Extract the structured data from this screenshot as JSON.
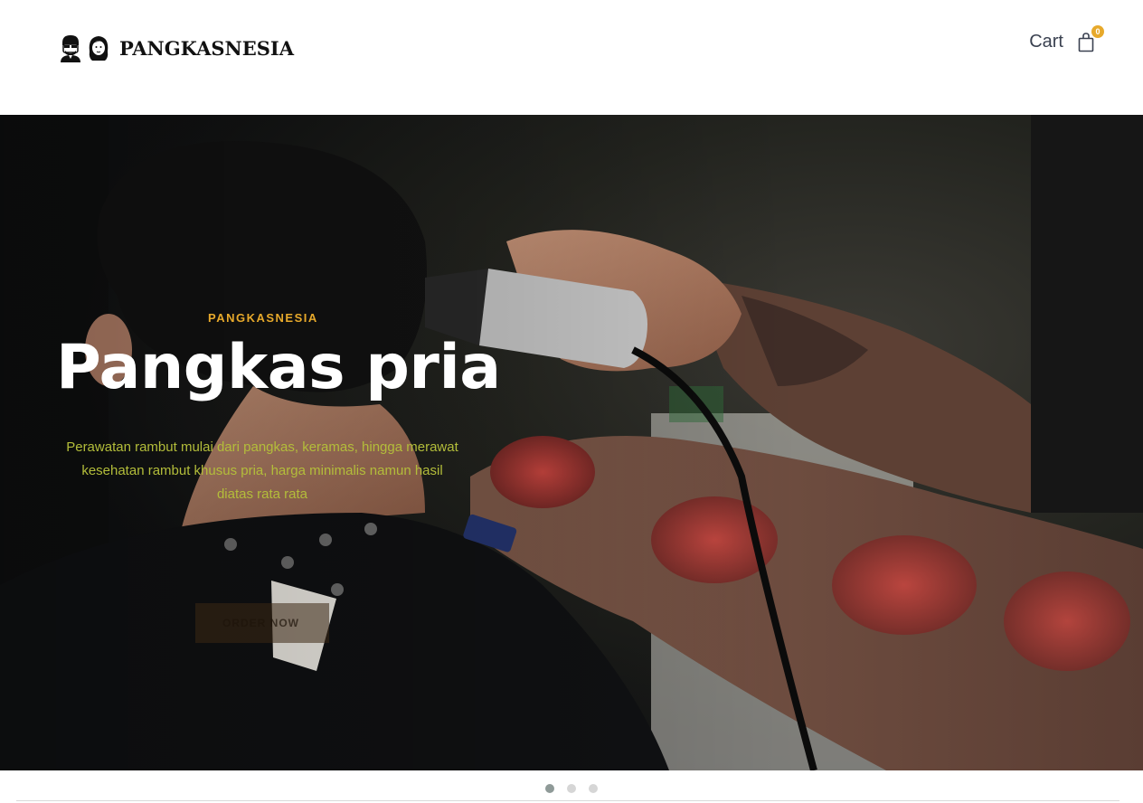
{
  "header": {
    "logo_text": "PANGKASNESIA",
    "cart_label": "Cart",
    "cart_count": "0"
  },
  "hero": {
    "kicker": "PANGKASNESIA",
    "title": "Pangkas pria",
    "description": "Perawatan rambut mulai dari pangkas, keramas, hingga merawat kesehatan rambut khusus pria, harga minimalis namun hasil diatas rata rata",
    "button_label": "ORDER NOW"
  },
  "slider": {
    "slide_count": 3,
    "active_index": 0
  },
  "colors": {
    "accent": "#e7a92b",
    "description_text": "#b3bd3a",
    "cart_text": "#3a4150"
  }
}
